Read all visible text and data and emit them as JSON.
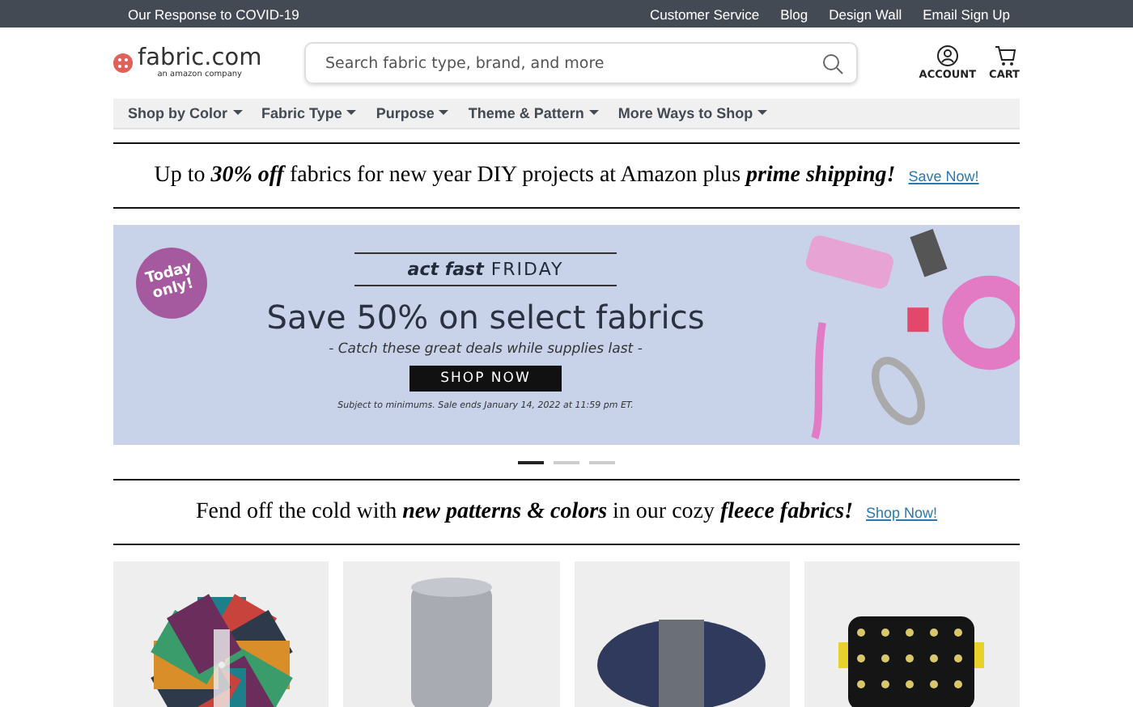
{
  "top_bar": {
    "left_link": "Our Response to COVID-19",
    "links": [
      "Customer Service",
      "Blog",
      "Design Wall",
      "Email Sign Up"
    ]
  },
  "header": {
    "logo": {
      "name": "fabric.com",
      "tagline": "an amazon company"
    },
    "search": {
      "placeholder": "Search fabric type, brand, and more"
    },
    "actions": [
      {
        "label": "ACCOUNT",
        "kind": "account"
      },
      {
        "label": "CART",
        "kind": "cart"
      }
    ]
  },
  "nav": [
    "Shop by Color",
    "Fabric Type",
    "Purpose",
    "Theme & Pattern",
    "More Ways to Shop"
  ],
  "promo_1": {
    "text": "Up to **30% off** fabrics for new year DIY projects at Amazon plus **prime shipping!**",
    "link": "Save Now!"
  },
  "banner": {
    "badge": "Today only!",
    "eyebrow_bold": "act fast",
    "eyebrow": "FRIDAY",
    "headline": "Save 50% on select fabrics",
    "subline": "- Catch these great deals while supplies last -",
    "button": "SHOP NOW",
    "fine_print": "Subject to minimums. Sale ends January 14, 2022 at 11:59 pm ET."
  },
  "carousel_dots": [
    {
      "selected": true
    },
    {
      "selected": false
    },
    {
      "selected": false
    }
  ],
  "promo_2": {
    "text": "Fend off the cold with **new patterns & colors** in our cozy **fleece fabrics!**",
    "link": "Shop Now!"
  },
  "products": [
    {
      "kind": "fabric"
    },
    {
      "kind": "roll"
    },
    {
      "kind": "yarn"
    },
    {
      "kind": "bag"
    }
  ]
}
